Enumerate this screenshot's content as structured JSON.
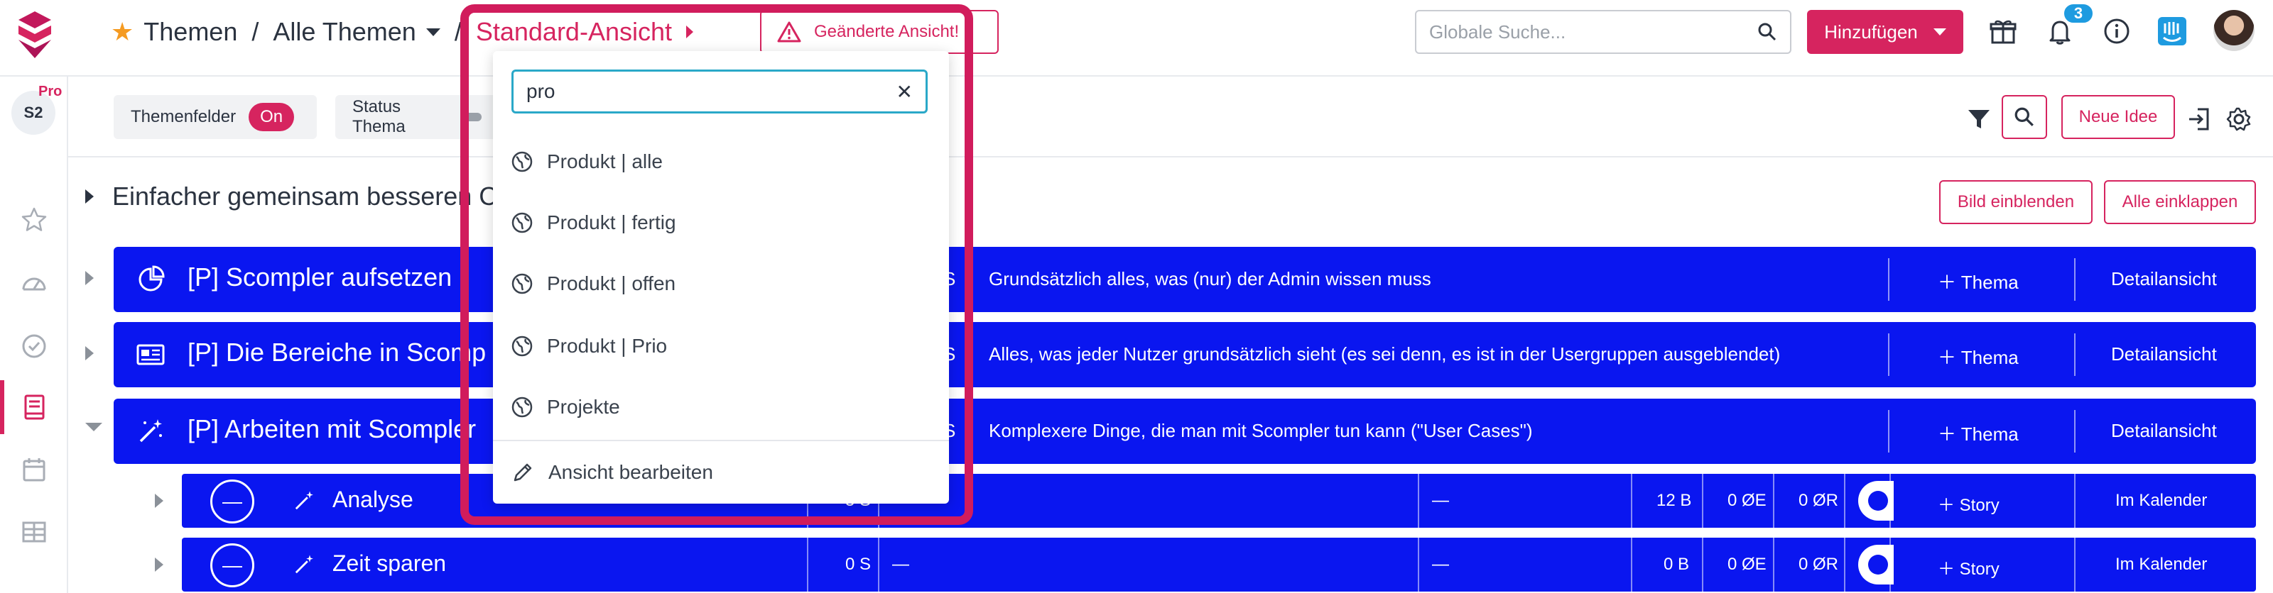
{
  "header": {
    "breadcrumb": [
      "Themen",
      "Alle Themen",
      "Standard-Ansicht"
    ],
    "separator": "/",
    "changed_view_label": "Geänderte Ansicht!",
    "global_search_placeholder": "Globale Suche...",
    "add_label": "Hinzufügen",
    "notification_count": "3",
    "icons": [
      "logo-icon",
      "star-icon",
      "warning-icon",
      "search-icon",
      "gift-icon",
      "bell-icon",
      "info-icon",
      "intercom-icon",
      "avatar"
    ]
  },
  "workspace": {
    "initials": "S2",
    "plan": "Pro"
  },
  "sidebar": {
    "icons": [
      "star-icon",
      "dashboard-icon",
      "check-circle-icon",
      "book-icon",
      "calendar-icon",
      "table-icon"
    ],
    "active": "book-icon"
  },
  "filters": [
    {
      "label": "Themenfelder",
      "value": "On"
    },
    {
      "label": "Status Thema",
      "value": ""
    }
  ],
  "toolbar": {
    "new_idea_label": "Neue Idee"
  },
  "section": {
    "title": "Einfacher gemeinsam besseren C",
    "show_image_label": "Bild einblenden",
    "collapse_all_label": "Alle einklappen"
  },
  "rows": [
    {
      "icon": "chart-pie-icon",
      "title": "[P] Scompler aufsetzen",
      "short": "S",
      "desc": "Grundsätzlich alles, was (nur) der Admin wissen muss",
      "add_label": "Thema",
      "detail_label": "Detailansicht"
    },
    {
      "icon": "newspaper-icon",
      "title": "[P] Die Bereiche in Scomp",
      "short": "S",
      "desc": "Alles, was jeder Nutzer grundsätzlich sieht (es sei denn, es ist in der Usergruppen ausgeblendet)",
      "add_label": "Thema",
      "detail_label": "Detailansicht"
    },
    {
      "icon": "magic-wand-icon",
      "title": "[P] Arbeiten mit Scompler",
      "short": "S",
      "desc": "Komplexere Dinge, die man mit Scompler tun kann (\"User Cases\")",
      "add_label": "Thema",
      "detail_label": "Detailansicht"
    }
  ],
  "subrows": [
    {
      "status": "—",
      "title": "Analyse",
      "s": "5 S",
      "dash1": "",
      "dash2": "—",
      "b": "12 B",
      "e": "0 ØE",
      "r": "0 ØR",
      "add_label": "Story",
      "calendar_label": "Im Kalender"
    },
    {
      "status": "—",
      "title": "Zeit sparen",
      "s": "0 S",
      "dash1": "—",
      "dash2": "—",
      "b": "0 B",
      "e": "0 ØE",
      "r": "0 ØR",
      "add_label": "Story",
      "calendar_label": "Im Kalender"
    }
  ],
  "view_dropdown": {
    "search_value": "pro",
    "options": [
      "Produkt | alle",
      "Produkt | fertig",
      "Produkt | offen",
      "Produkt | Prio",
      "Projekte"
    ],
    "option_icon": "globe-icon",
    "edit_label": "Ansicht bearbeiten",
    "edit_icon": "pencil-icon"
  },
  "colors": {
    "accent": "#d6245f",
    "row_blue": "#0a16f0",
    "highlight": "#d11c5c",
    "badge": "#1e9be0"
  }
}
